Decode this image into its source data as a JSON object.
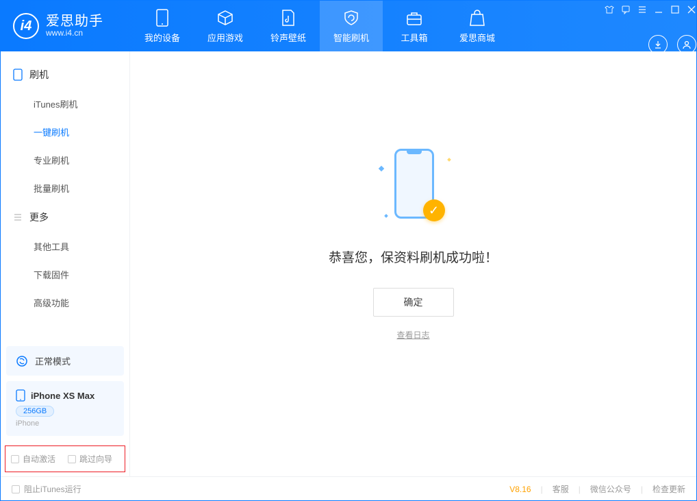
{
  "app": {
    "title": "爱思助手",
    "subtitle": "www.i4.cn"
  },
  "nav": {
    "items": [
      {
        "label": "我的设备"
      },
      {
        "label": "应用游戏"
      },
      {
        "label": "铃声壁纸"
      },
      {
        "label": "智能刷机"
      },
      {
        "label": "工具箱"
      },
      {
        "label": "爱思商城"
      }
    ],
    "active_index": 3
  },
  "sidebar": {
    "groups": [
      {
        "title": "刷机",
        "items": [
          "iTunes刷机",
          "一键刷机",
          "专业刷机",
          "批量刷机"
        ],
        "active_index": 1
      },
      {
        "title": "更多",
        "items": [
          "其他工具",
          "下载固件",
          "高级功能"
        ],
        "active_index": -1
      }
    ],
    "mode_label": "正常模式",
    "device": {
      "name": "iPhone XS Max",
      "capacity": "256GB",
      "type": "iPhone"
    },
    "checkboxes": {
      "auto_activate": "自动激活",
      "skip_guide": "跳过向导"
    }
  },
  "main": {
    "success_message": "恭喜您，保资料刷机成功啦！",
    "ok_button": "确定",
    "view_log": "查看日志"
  },
  "footer": {
    "block_itunes": "阻止iTunes运行",
    "version": "V8.16",
    "links": [
      "客服",
      "微信公众号",
      "检查更新"
    ]
  }
}
